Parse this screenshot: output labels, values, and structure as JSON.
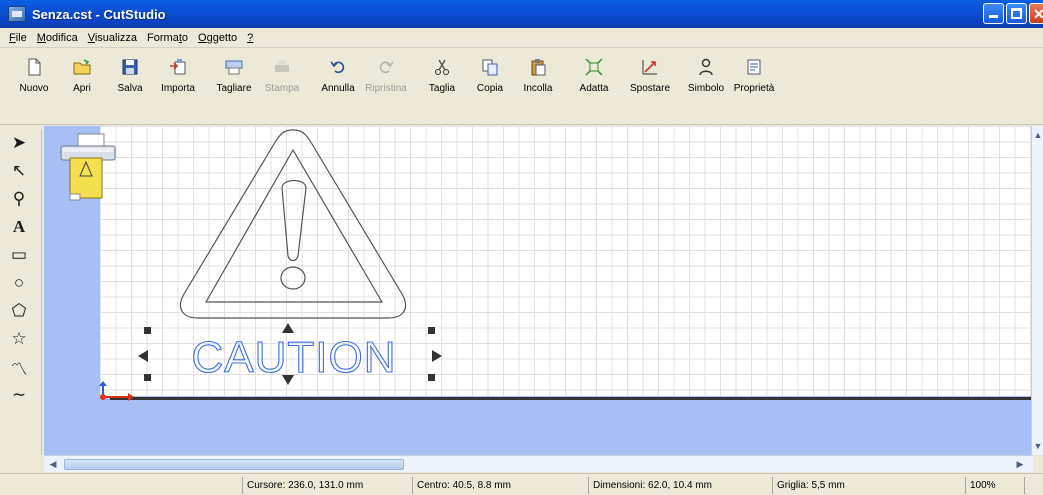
{
  "window": {
    "title": "Senza.cst - CutStudio"
  },
  "menu": [
    {
      "label": "File",
      "accel": "F",
      "rest": "ile"
    },
    {
      "label": "Modifica",
      "accel": "M",
      "rest": "odifica"
    },
    {
      "label": "Visualizza",
      "accel": "V",
      "rest": "isualizza"
    },
    {
      "label": "Formato",
      "pre": "Forma",
      "accel": "t",
      "rest": "o"
    },
    {
      "label": "Oggetto",
      "accel": "O",
      "rest": "ggetto"
    },
    {
      "label": "?",
      "accel": "?",
      "rest": ""
    }
  ],
  "toolbar": {
    "nuovo": "Nuovo",
    "apri": "Apri",
    "salva": "Salva",
    "importa": "Importa",
    "tagliare": "Tagliare",
    "stampa": "Stampa",
    "annulla": "Annulla",
    "ripristina": "Ripristina",
    "taglia": "Taglia",
    "copia": "Copia",
    "incolla": "Incolla",
    "adatta": "Adatta",
    "spostare": "Spostare",
    "simbolo": "Simbolo",
    "proprieta": "Proprietà"
  },
  "canvas": {
    "caution_text": "CAUTION"
  },
  "status": {
    "cursore": "Cursore: 236.0, 131.0 mm",
    "centro": "Centro: 40.5, 8.8 mm",
    "dimensioni": "Dimensioni: 62.0, 10.4 mm",
    "griglia": "Griglia: 5,5 mm",
    "zoom": "100%"
  },
  "colors": {
    "titlebar": "#0b4fd3",
    "canvas_bg": "#a6bff5",
    "outline_blue": "#3b6ee8"
  }
}
